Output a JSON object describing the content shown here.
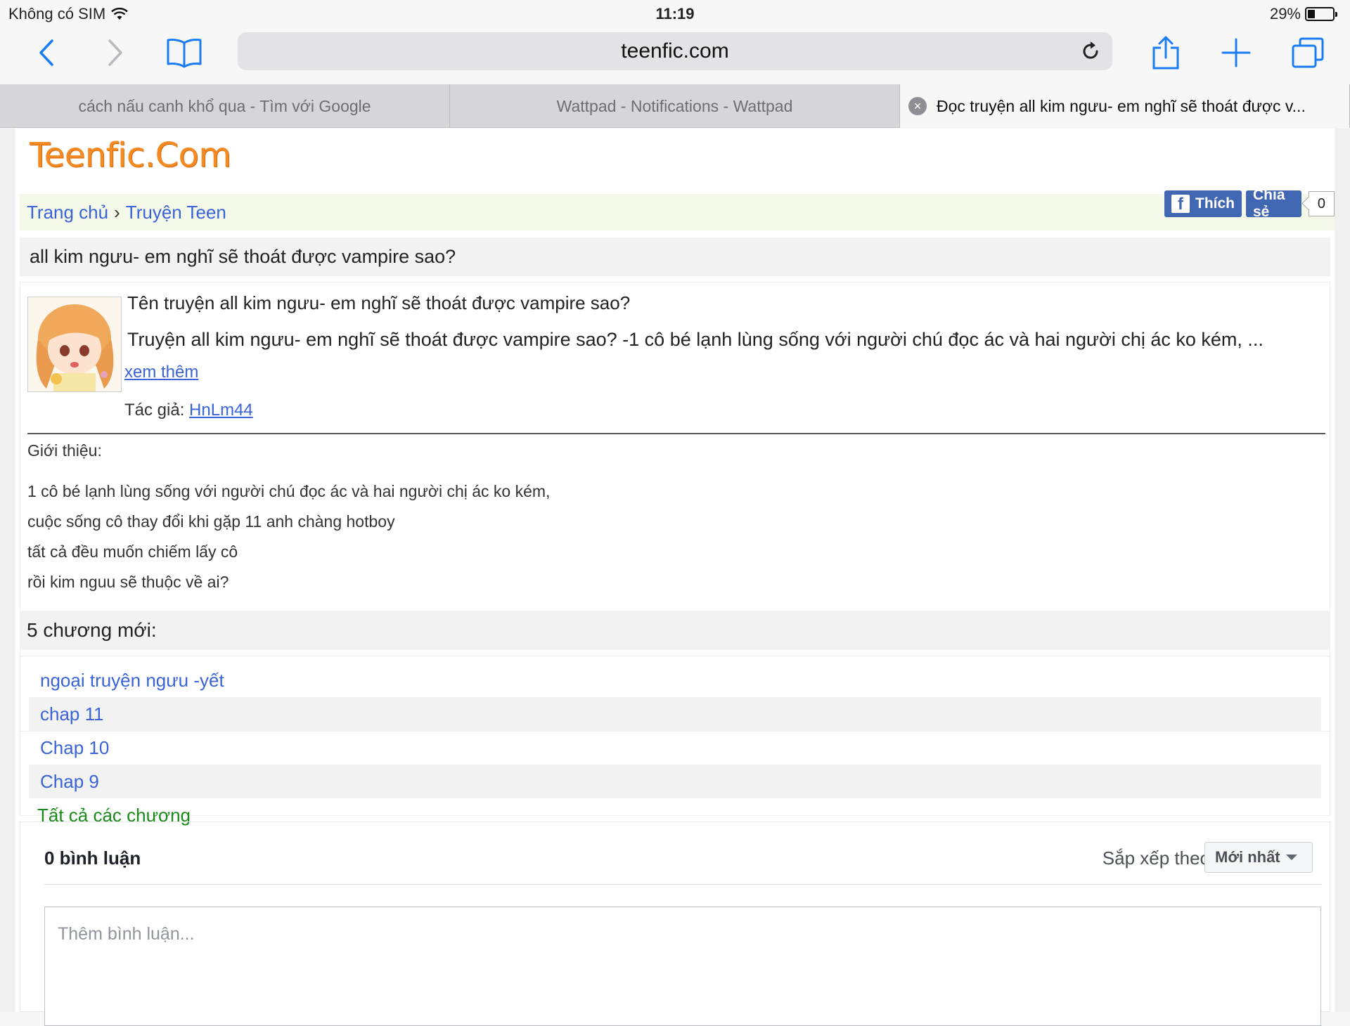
{
  "status_bar": {
    "carrier": "Không có SIM",
    "time": "11:19",
    "battery": "29%",
    "battery_level": 0.29
  },
  "browser": {
    "url": "teenfic.com",
    "tabs": [
      {
        "title": "cách nấu canh khổ qua - Tìm với Google"
      },
      {
        "title": "Wattpad - Notifications - Wattpad"
      },
      {
        "title": "Đọc truyện all kim ngưu- em nghĩ sẽ thoát được v..."
      }
    ]
  },
  "site": {
    "logo": "Teenfic.Com",
    "breadcrumb": {
      "home": "Trang chủ",
      "sep": "›",
      "category": "Truyện Teen"
    },
    "facebook": {
      "like": "Thích",
      "share": "Chia sẻ",
      "count": "0"
    }
  },
  "story": {
    "heading": "all kim ngưu- em nghĩ sẽ thoát được vampire sao?",
    "name_line": "Tên truyện all kim ngưu- em nghĩ sẽ thoát được vampire sao?",
    "summary_line": "Truyện all kim ngưu- em nghĩ sẽ thoát được vampire sao? -1 cô bé lạnh lùng sống với người chú đọc ác và hai người chị ác ko kém, ...",
    "more": "xem thêm",
    "author_label": "Tác giả: ",
    "author": "HnLm44",
    "intro_label": "Giới thiệu:",
    "intro_lines": [
      "1 cô bé lạnh lùng sống với người chú đọc ác và hai người chị ác ko kém,",
      "cuộc sống cô thay đổi khi gặp 11 anh chàng hotboy",
      "tất cả đều muốn chiếm lấy cô",
      "rồi kim nguu sẽ thuộc về ai?"
    ]
  },
  "chapters": {
    "heading": "5 chương mới:",
    "items": [
      "ngoại truyện ngưu -yết",
      "chap 11",
      "Chap 10",
      "Chap 9"
    ],
    "all": "Tất cả các chương"
  },
  "comments": {
    "count": "0 bình luận",
    "sort_label": "Sắp xếp theo",
    "sort_value": "Mới nhất",
    "placeholder": "Thêm bình luận..."
  },
  "colors": {
    "link": "#3a63d9",
    "logo": "#f58a23",
    "facebook": "#4267b2",
    "all_chapters": "#1a8a1a",
    "ios_blue": "#1a7cf5"
  },
  "icons": [
    "back-icon",
    "forward-icon",
    "bookmarks-icon",
    "reload-icon",
    "share-icon",
    "new-tab-icon",
    "tabs-icon",
    "close-tab-icon",
    "wifi-icon",
    "facebook-icon"
  ]
}
